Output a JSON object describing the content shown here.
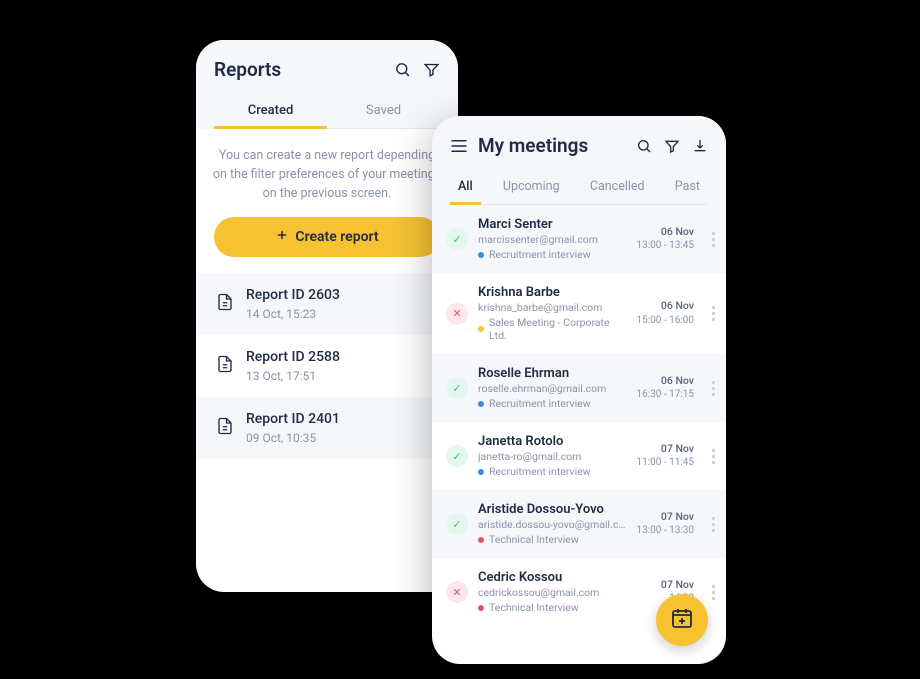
{
  "reports": {
    "title": "Reports",
    "tabs": {
      "created": "Created",
      "saved": "Saved"
    },
    "info": "You can create a new report depending on the filter preferences of your meetings on the previous screen.",
    "create_label": "Create report",
    "items": [
      {
        "id": "Report ID 2603",
        "date": "14 Oct, 15:23"
      },
      {
        "id": "Report ID 2588",
        "date": "13 Oct, 17:51"
      },
      {
        "id": "Report ID 2401",
        "date": "09 Oct, 10:35"
      }
    ]
  },
  "meetings": {
    "title": "My meetings",
    "tabs": {
      "all": "All",
      "upcoming": "Upcoming",
      "cancelled": "Cancelled",
      "past": "Past"
    },
    "items": [
      {
        "name": "Marci Senter",
        "email": "marcissenter@gmail.com",
        "type": "Recruitment interview",
        "dot": "blue",
        "status": "ok",
        "date": "06 Nov",
        "time": "13:00 - 13:45"
      },
      {
        "name": "Krishna Barbe",
        "email": "krishna_barbe@gmail.com",
        "type": "Sales Meeting - Corporate Ltd.",
        "dot": "yellow",
        "status": "cancel",
        "date": "06 Nov",
        "time": "15:00 - 16:00"
      },
      {
        "name": "Roselle Ehrman",
        "email": "roselle.ehrman@gmail.com",
        "type": "Recruitment interview",
        "dot": "blue",
        "status": "ok",
        "date": "06 Nov",
        "time": "16:30 - 17:15"
      },
      {
        "name": "Janetta Rotolo",
        "email": "janetta-ro@gmail.com",
        "type": "Recruitment interview",
        "dot": "blue",
        "status": "ok",
        "date": "07 Nov",
        "time": "11:00 - 11:45"
      },
      {
        "name": "Aristide Dossou-Yovo",
        "email": "aristide.dossou-yovo@gmail.com",
        "type": "Technical Interview",
        "dot": "red",
        "status": "ok",
        "date": "07 Nov",
        "time": "13:00 - 13:30"
      },
      {
        "name": "Cedric Kossou",
        "email": "cedrickossou@gmail.com",
        "type": "Technical Interview",
        "dot": "red",
        "status": "cancel",
        "date": "07 Nov",
        "time": "14:00"
      }
    ]
  },
  "colors": {
    "accent": "#f6c232",
    "text_dark": "#1f2a44",
    "text_muted": "#8a93a6",
    "dot_blue": "#3a8dde",
    "dot_yellow": "#f6c232",
    "dot_red": "#e25563"
  }
}
